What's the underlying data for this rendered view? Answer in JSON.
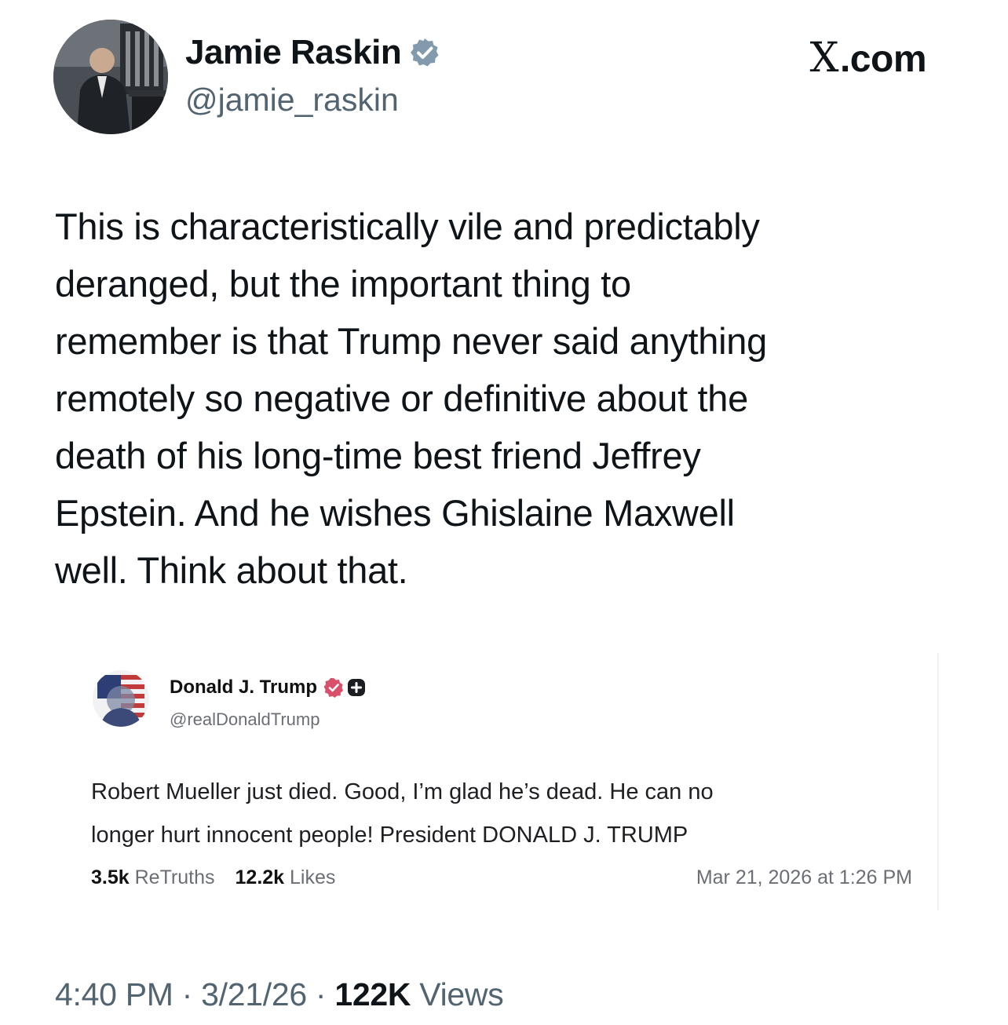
{
  "header": {
    "author_name": "Jamie Raskin",
    "author_handle": "@jamie_raskin",
    "site_label": ".com",
    "site_logo": "X"
  },
  "post": {
    "text": "This is characteristically vile and predictably\nderanged, but the important thing to\nremember is that Trump never said anything\nremotely so negative or definitive about the\ndeath of his long-time best friend Jeffrey\nEpstein. And he wishes Ghislaine Maxwell\nwell. Think about that."
  },
  "quote": {
    "author_name": "Donald J. Trump",
    "author_handle": "@realDonaldTrump",
    "text": "Robert Mueller just died. Good, I’m glad he’s dead. He can no\nlonger hurt innocent people! President DONALD J. TRUMP",
    "retruths_count": "3.5k",
    "retruths_label": "ReTruths",
    "likes_count": "12.2k",
    "likes_label": "Likes",
    "date": "Mar 21, 2026 at 1:26 PM"
  },
  "meta": {
    "time": "4:40 PM",
    "separator": " · ",
    "date": "3/21/26",
    "views_count": "122K",
    "views_label": " Views"
  },
  "colors": {
    "verified_badge": "#829aab",
    "truth_verified_badge": "#d9506b",
    "secondary_text": "#536471"
  }
}
